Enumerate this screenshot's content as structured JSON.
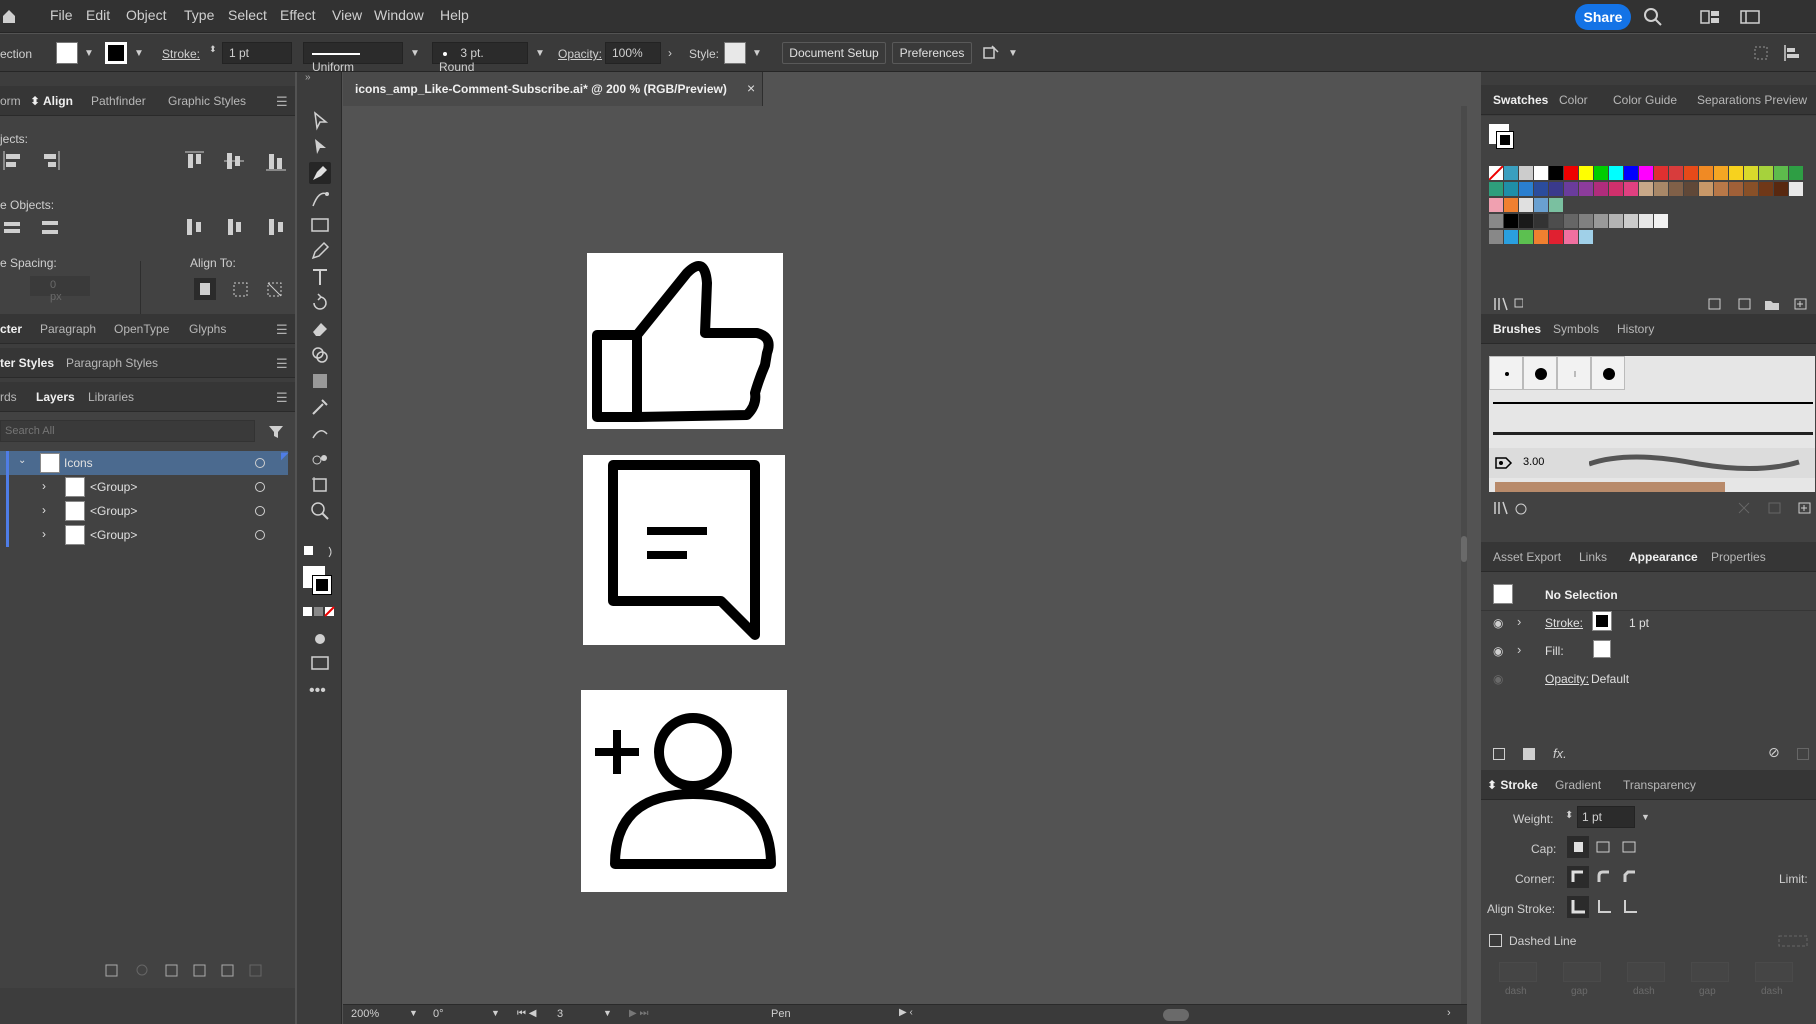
{
  "menubar": {
    "items": [
      "File",
      "Edit",
      "Object",
      "Type",
      "Select",
      "Effect",
      "View",
      "Window",
      "Help"
    ],
    "share_label": "Share"
  },
  "controlbar": {
    "selection_label": "ection",
    "stroke_label": "Stroke:",
    "stroke_weight": "1 pt",
    "uniform_label": "Uniform",
    "brush_label": "3 pt. Round",
    "opacity_label": "Opacity:",
    "opacity_value": "100%",
    "style_label": "Style:",
    "document_setup": "Document Setup",
    "preferences": "Preferences"
  },
  "left_panel": {
    "align_tabs": [
      "orm",
      "Align",
      "Pathfinder",
      "Graphic Styles"
    ],
    "align_objects_label": "jects:",
    "distribute_objects_label": "e Objects:",
    "distribute_spacing_label": "e Spacing:",
    "align_to_label": "Align To:",
    "spacing_value": "0 px",
    "char_tabs": [
      "cter",
      "Paragraph",
      "OpenType",
      "Glyphs"
    ],
    "style_tabs": [
      "ter Styles",
      "Paragraph Styles"
    ],
    "layer_tabs": [
      "rds",
      "Layers",
      "Libraries"
    ],
    "search_placeholder": "Search All",
    "layers": [
      {
        "name": "Icons"
      },
      {
        "name": "<Group>"
      },
      {
        "name": "<Group>"
      },
      {
        "name": "<Group>"
      }
    ]
  },
  "document": {
    "tab_title": "icons_amp_Like-Comment-Subscribe.ai* @ 200 % (RGB/Preview)",
    "close": "×"
  },
  "statusbar": {
    "zoom": "200%",
    "rotation": "0°",
    "artboard": "3",
    "tool": "Pen"
  },
  "right_panel": {
    "swatch_tabs": [
      "Swatches",
      "Color",
      "Color Guide",
      "Separations Preview"
    ],
    "brush_tabs": [
      "Brushes",
      "Symbols",
      "History"
    ],
    "brush_size": "3.00",
    "appearance_tabs": [
      "Asset Export",
      "Links",
      "Appearance",
      "Properties"
    ],
    "appearance": {
      "no_selection": "No Selection",
      "stroke_label": "Stroke:",
      "stroke_value": "1 pt",
      "fill_label": "Fill:",
      "opacity_label": "Opacity:",
      "opacity_value": "Default",
      "fx_label": "fx."
    },
    "stroke_tabs": [
      "Stroke",
      "Gradient",
      "Transparency"
    ],
    "stroke": {
      "weight_label": "Weight:",
      "weight_value": "1 pt",
      "cap_label": "Cap:",
      "corner_label": "Corner:",
      "limit_label": "Limit:",
      "align_label": "Align Stroke:",
      "dashed_label": "Dashed Line",
      "dash_labels": [
        "dash",
        "gap",
        "dash",
        "gap",
        "dash"
      ]
    }
  },
  "colors": {
    "accent": "#1473e6",
    "canvas": "#535353",
    "panel": "#424242",
    "selected_layer": "#4b6a8f"
  }
}
